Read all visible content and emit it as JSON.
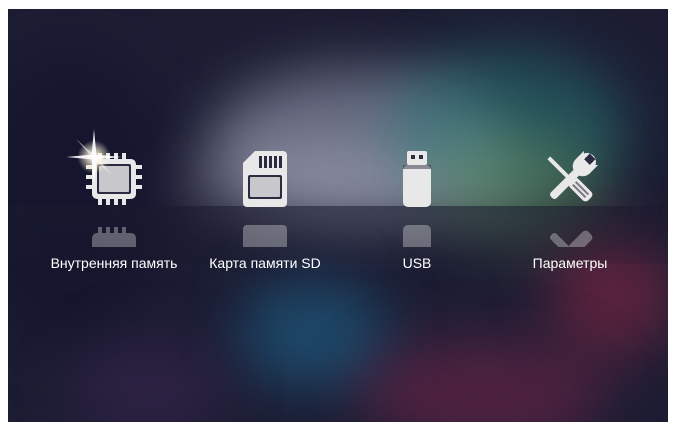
{
  "menu": {
    "items": [
      {
        "label": "Внутренняя память",
        "icon": "internal-memory-chip-icon"
      },
      {
        "label": "Карта памяти SD",
        "icon": "sd-card-icon"
      },
      {
        "label": "USB",
        "icon": "usb-drive-icon"
      },
      {
        "label": "Параметры",
        "icon": "settings-tools-icon"
      }
    ],
    "selected_index": 0
  },
  "colors": {
    "background": "#1c1d33",
    "label": "#ffffff",
    "icon": "#e8e8e8"
  }
}
